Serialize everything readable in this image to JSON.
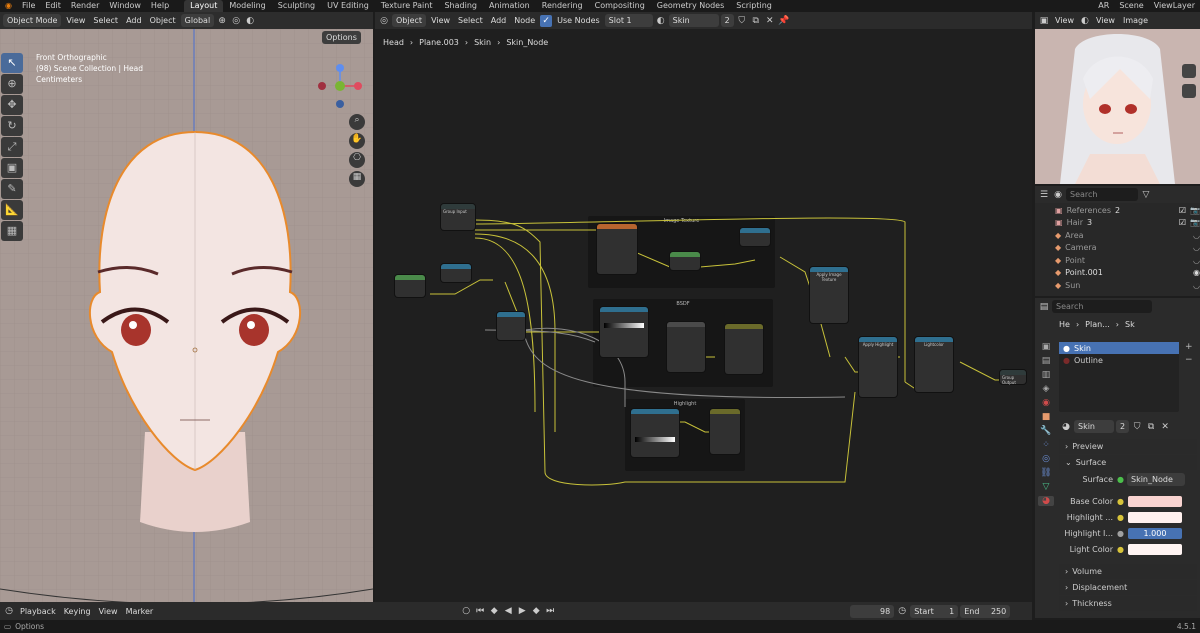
{
  "topbar": {
    "menus": [
      "File",
      "Edit",
      "Render",
      "Window",
      "Help"
    ],
    "workspaces": [
      "Layout",
      "Modeling",
      "Sculpting",
      "UV Editing",
      "Texture Paint",
      "Shading",
      "Animation",
      "Rendering",
      "Compositing",
      "Geometry Nodes",
      "Scripting"
    ],
    "active_workspace": "Layout",
    "scene": "Scene",
    "ar": "AR",
    "view_layer": "ViewLayer"
  },
  "viewport": {
    "mode": "Object Mode",
    "menus": [
      "View",
      "Select",
      "Add",
      "Object"
    ],
    "transform": "Global",
    "options": "Options",
    "info_line1": "Front Orthographic",
    "info_line2": "(98) Scene Collection | Head",
    "info_line3": "Centimeters"
  },
  "node_editor": {
    "type": "Object",
    "menus": [
      "View",
      "Select",
      "Add",
      "Node"
    ],
    "use_nodes": "Use Nodes",
    "slot": "Slot 1",
    "material": "Skin",
    "users": "2",
    "breadcrumb": [
      "Head",
      "Plane.003",
      "Skin",
      "Skin_Node"
    ],
    "frames": {
      "image_texture": "Image Texture",
      "bsdf": "BSDF",
      "highlight": "Highlight",
      "apply_image": "Apply Image Texture",
      "apply_highlight": "Apply Highlight",
      "lightcolor": "Lightcolor",
      "group_input": "Group Input",
      "group_output": "Group Output"
    }
  },
  "preview": {
    "menus": [
      "View",
      "View",
      "Image"
    ]
  },
  "outliner": {
    "search_placeholder": "Search",
    "items": [
      {
        "name": "References",
        "count": "2",
        "color": "#e0a0a0"
      },
      {
        "name": "Hair",
        "count": "3",
        "color": "#e0a0a0"
      },
      {
        "name": "Area",
        "count": "",
        "color": "#e69a6d"
      },
      {
        "name": "Camera",
        "count": "",
        "color": "#e69a6d"
      },
      {
        "name": "Point",
        "count": "",
        "color": "#e69a6d"
      },
      {
        "name": "Point.001",
        "count": "",
        "color": "#e69a6d"
      },
      {
        "name": "Sun",
        "count": "",
        "color": "#e69a6d"
      }
    ]
  },
  "properties": {
    "search_placeholder": "Search",
    "crumb": [
      "He",
      "Plan...",
      "Sk"
    ],
    "slots": [
      "Skin",
      "Outline"
    ],
    "material_name": "Skin",
    "users": "2",
    "sections": [
      "Preview",
      "Surface",
      "Volume",
      "Displacement",
      "Thickness"
    ],
    "surface_label": "Surface",
    "surface_value": "Skin_Node",
    "inputs": [
      {
        "label": "Base Color",
        "type": "color"
      },
      {
        "label": "Highlight ...",
        "type": "color"
      },
      {
        "label": "Highlight I...",
        "type": "value",
        "value": "1.000"
      },
      {
        "label": "Light Color",
        "type": "color"
      }
    ]
  },
  "timeline": {
    "playback": "Playback",
    "keying": "Keying",
    "view": "View",
    "marker": "Marker",
    "frame": "98",
    "start_label": "Start",
    "start": "1",
    "end_label": "End",
    "end": "250"
  },
  "status": {
    "left": "Options",
    "version": "4.5.1"
  },
  "colors": {
    "accent": "#4772b3",
    "wire": "#c8c23a",
    "skin": "#f2d8d3"
  }
}
